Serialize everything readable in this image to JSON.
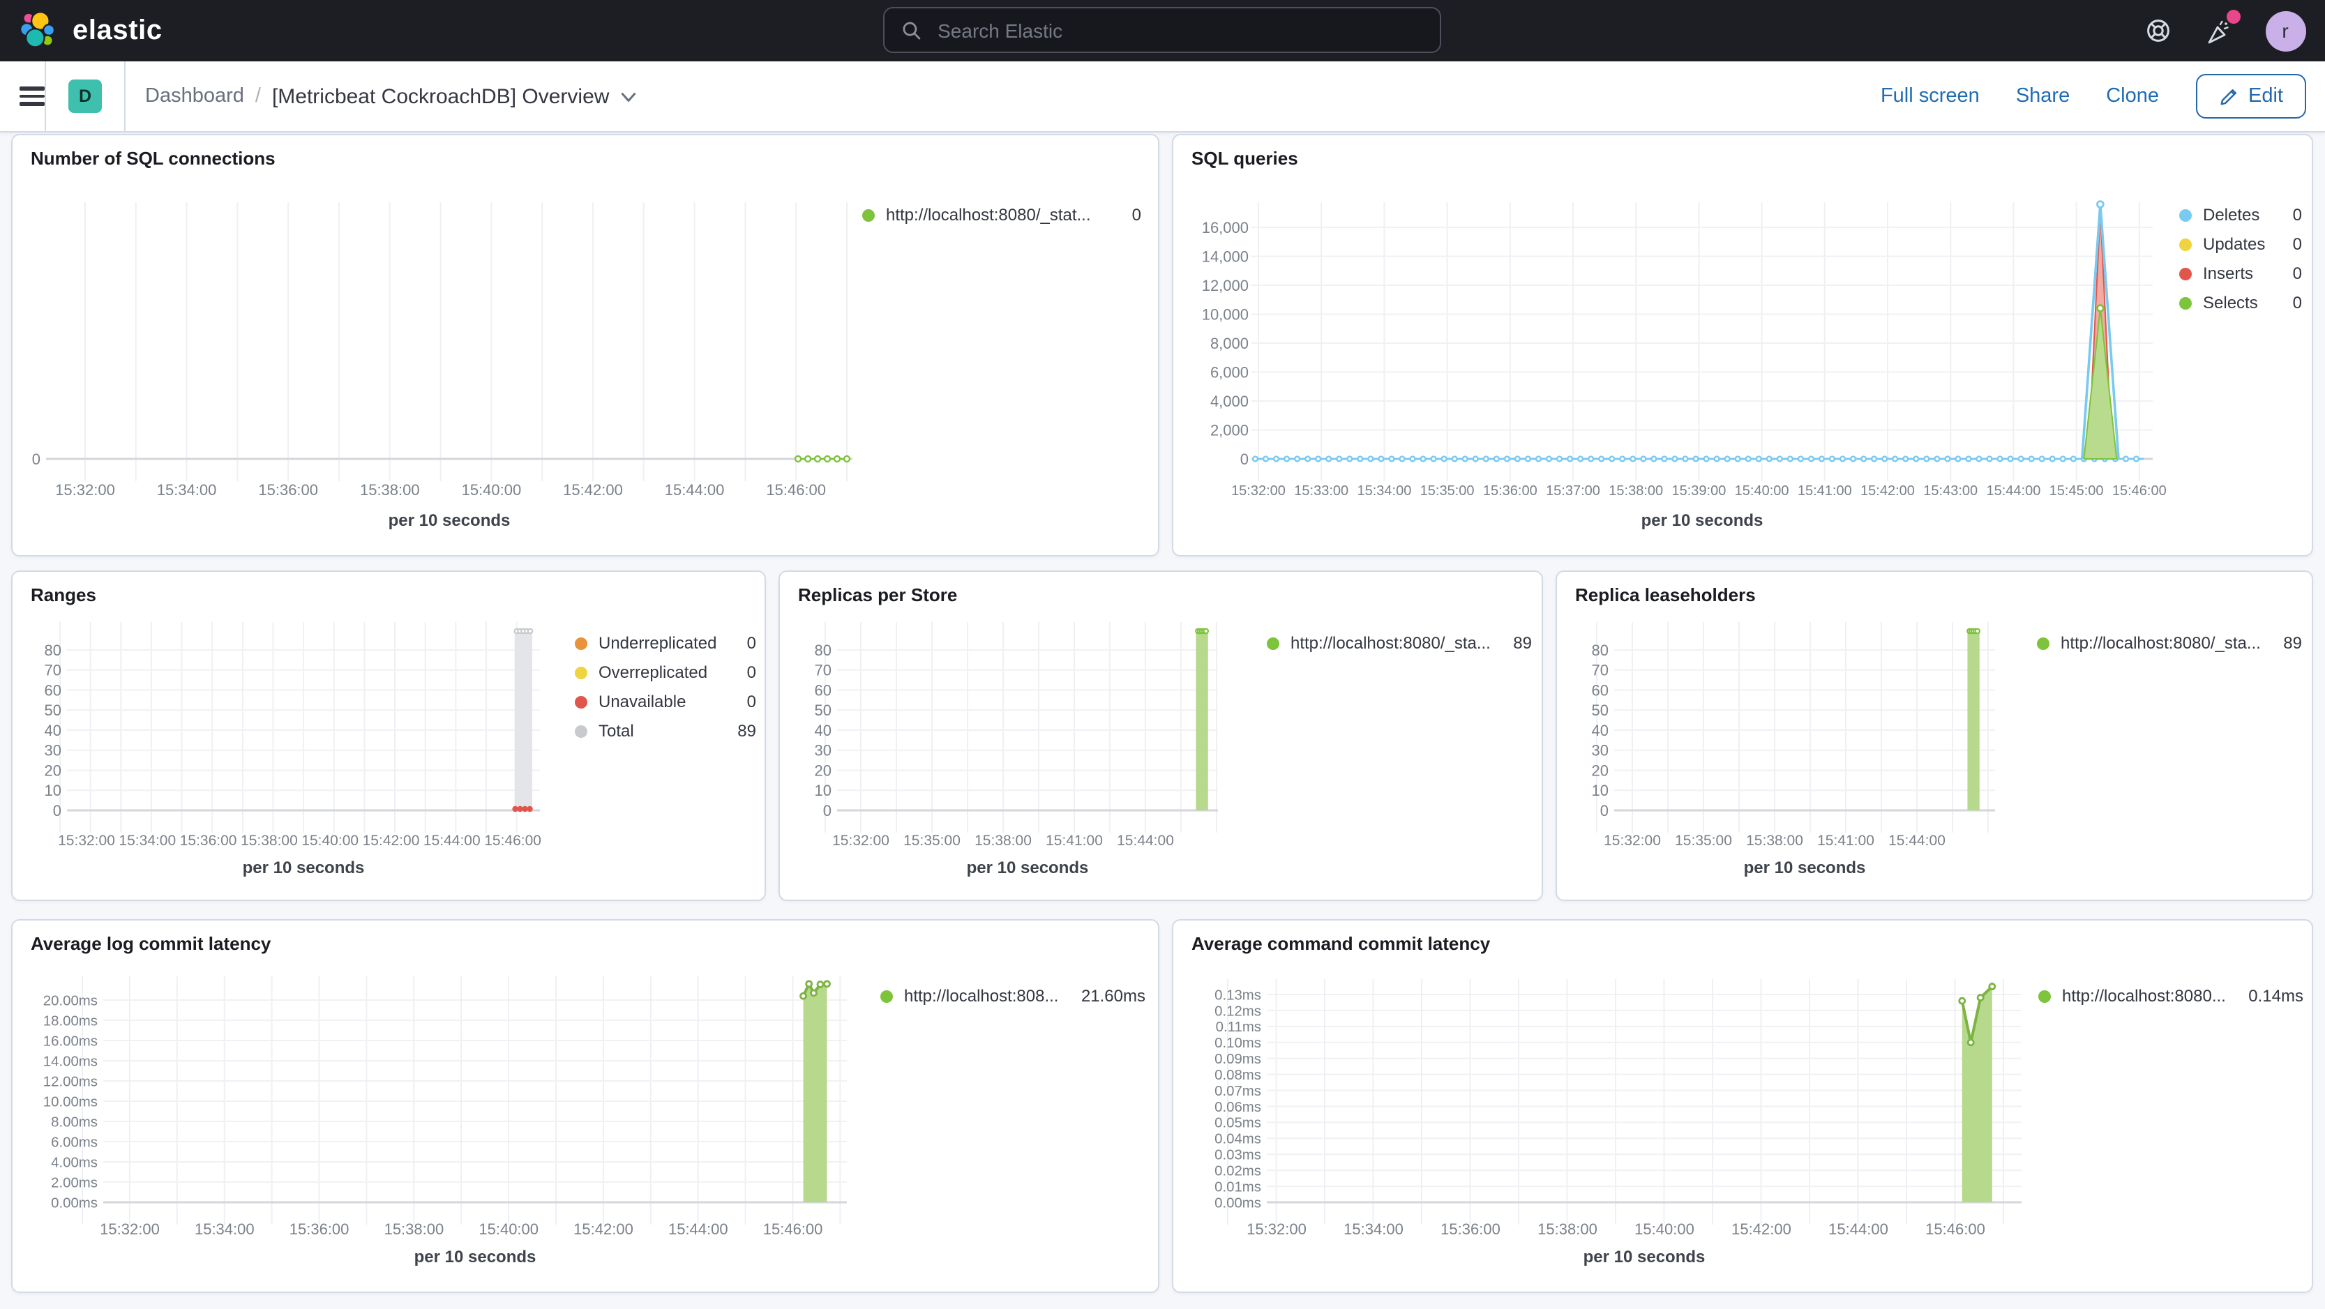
{
  "header": {
    "logo": "elastic",
    "search_placeholder": "Search Elastic",
    "avatar_initial": "r"
  },
  "nav": {
    "badge": "D",
    "breadcrumb_root": "Dashboard",
    "separator": "/",
    "title": "[Metricbeat CockroachDB] Overview",
    "actions": [
      "Full screen",
      "Share",
      "Clone"
    ],
    "edit_label": "Edit"
  },
  "colors": {
    "header_bg": "#1d1e24",
    "page_bg": "#f5f7fa",
    "link_blue": "#1e6cb3",
    "badge_teal": "#3fbfae",
    "accent_pink": "#e8478b",
    "series_green": "#7DC33B",
    "series_blue": "#79C9F1",
    "series_yellow": "#EFD33F",
    "series_red": "#E0564A",
    "series_orange": "#E8933C",
    "series_gray": "#C9CACE"
  },
  "panels": [
    {
      "title": "Number of SQL connections",
      "legend": [
        {
          "color": "#7DC33B",
          "label": "http://localhost:8080/_stat...",
          "value": "0"
        }
      ],
      "chart_data": {
        "type": "line",
        "x_axis_title": "per 10 seconds",
        "x_ticks": [
          "15:32:00",
          "15:34:00",
          "15:36:00",
          "15:38:00",
          "15:40:00",
          "15:42:00",
          "15:44:00",
          "15:46:00"
        ],
        "y_ticks": [
          {
            "v": 0,
            "label": "0"
          }
        ],
        "series": [
          {
            "name": "http://localhost:8080/_stat...",
            "color": "#7DC33B",
            "type": "dotline",
            "value": 0,
            "from_unit": 7.02,
            "to_unit": 7.5,
            "marker_step_unit": 0.096,
            "marker_r": 2
          }
        ]
      }
    },
    {
      "title": "SQL queries",
      "legend": [
        {
          "color": "#79C9F1",
          "label": "Deletes",
          "value": "0"
        },
        {
          "color": "#EFD33F",
          "label": "Updates",
          "value": "0"
        },
        {
          "color": "#E0564A",
          "label": "Inserts",
          "value": "0"
        },
        {
          "color": "#7DC33B",
          "label": "Selects",
          "value": "0"
        }
      ],
      "chart_data": {
        "type": "area",
        "stacked": true,
        "x_axis_title": "per 10 seconds",
        "x_ticks": [
          "15:32:00",
          "15:33:00",
          "15:34:00",
          "15:35:00",
          "15:36:00",
          "15:37:00",
          "15:38:00",
          "15:39:00",
          "15:40:00",
          "15:41:00",
          "15:42:00",
          "15:43:00",
          "15:44:00",
          "15:45:00",
          "15:46:00"
        ],
        "y_ticks": [
          {
            "v": 0,
            "label": "0"
          },
          {
            "v": 2000,
            "label": "2,000"
          },
          {
            "v": 4000,
            "label": "4,000"
          },
          {
            "v": 6000,
            "label": "6,000"
          },
          {
            "v": 8000,
            "label": "8,000"
          },
          {
            "v": 10000,
            "label": "10,000"
          },
          {
            "v": 12000,
            "label": "12,000"
          },
          {
            "v": 14000,
            "label": "14,000"
          },
          {
            "v": 16000,
            "label": "16,000"
          }
        ],
        "series": [
          {
            "name": "Deletes",
            "color": "#79C9F1",
            "type": "dotline",
            "value": 0,
            "from_unit": -0.05,
            "to_unit": 14.07,
            "marker_step_unit": 0.1667,
            "marker_r": 1.7
          },
          {
            "name": "Updates",
            "color": "#EFD33F",
            "type": "none",
            "value": 0
          },
          {
            "name": "Inserts",
            "color": "#E0564A",
            "type": "spike",
            "fill": "#F1ABA2",
            "x_unit": 13.38,
            "half_width_unit": 0.19,
            "peak": 17180,
            "marker": false
          },
          {
            "name": "Selects",
            "color": "#7DC33B",
            "type": "spike",
            "fill": "#B9DB8D",
            "x_unit": 13.38,
            "half_width_unit": 0.26,
            "peak": 10410,
            "marker": true
          },
          {
            "name": "Deletes-spike-outline",
            "color": "#79C9F1",
            "type": "spike",
            "fill": "none",
            "x_unit": 13.38,
            "half_width_unit": 0.29,
            "peak": 17590,
            "marker": true
          }
        ]
      }
    },
    {
      "title": "Ranges",
      "legend": [
        {
          "color": "#E8933C",
          "label": "Underreplicated",
          "value": "0"
        },
        {
          "color": "#EFD33F",
          "label": "Overreplicated",
          "value": "0"
        },
        {
          "color": "#E0564A",
          "label": "Unavailable",
          "value": "0"
        },
        {
          "color": "#C9CACE",
          "label": "Total",
          "value": "89"
        }
      ],
      "chart_data": {
        "type": "bar",
        "x_axis_title": "per 10 seconds",
        "x_ticks": [
          "15:32:00",
          "15:34:00",
          "15:36:00",
          "15:38:00",
          "15:40:00",
          "15:42:00",
          "15:44:00",
          "15:46:00"
        ],
        "y_ticks": [
          {
            "v": 0,
            "label": "0"
          },
          {
            "v": 10,
            "label": "10"
          },
          {
            "v": 20,
            "label": "20"
          },
          {
            "v": 30,
            "label": "30"
          },
          {
            "v": 40,
            "label": "40"
          },
          {
            "v": 50,
            "label": "50"
          },
          {
            "v": 60,
            "label": "60"
          },
          {
            "v": 70,
            "label": "70"
          },
          {
            "v": 80,
            "label": "80"
          }
        ],
        "series": [
          {
            "name": "Total",
            "color": "#C9CACE",
            "type": "bar",
            "fill": "#E4E5E8",
            "x0_unit": 7.03,
            "x1_unit": 7.32,
            "value": 89,
            "top_markers": {
              "color": "#C6C8CC",
              "count": 5
            }
          },
          {
            "name": "Unavailable",
            "color": "#E0564A",
            "type": "dots",
            "from_unit": 7.04,
            "to_unit": 7.28,
            "count": 4,
            "value": 0
          }
        ]
      }
    },
    {
      "title": "Replicas per Store",
      "legend": [
        {
          "color": "#7DC33B",
          "label": "http://localhost:8080/_sta...",
          "value": "89"
        }
      ],
      "chart_data": {
        "type": "bar",
        "x_axis_title": "per 10 seconds",
        "x_ticks": [
          "15:32:00",
          "15:35:00",
          "15:38:00",
          "15:41:00",
          "15:44:00"
        ],
        "y_ticks": [
          {
            "v": 0,
            "label": "0"
          },
          {
            "v": 10,
            "label": "10"
          },
          {
            "v": 20,
            "label": "20"
          },
          {
            "v": 30,
            "label": "30"
          },
          {
            "v": 40,
            "label": "40"
          },
          {
            "v": 50,
            "label": "50"
          },
          {
            "v": 60,
            "label": "60"
          },
          {
            "v": 70,
            "label": "70"
          },
          {
            "v": 80,
            "label": "80"
          }
        ],
        "series": [
          {
            "name": "http://localhost:8080/_sta...",
            "color": "#7DC33B",
            "type": "bar",
            "fill": "#B6D98C",
            "x0_unit": 4.71,
            "x1_unit": 4.88,
            "value": 89,
            "top_markers": {
              "color": "#7DC33B",
              "count": 5
            }
          }
        ]
      }
    },
    {
      "title": "Replica leaseholders",
      "legend": [
        {
          "color": "#7DC33B",
          "label": "http://localhost:8080/_sta...",
          "value": "89"
        }
      ],
      "chart_data": {
        "type": "bar",
        "x_axis_title": "per 10 seconds",
        "x_ticks": [
          "15:32:00",
          "15:35:00",
          "15:38:00",
          "15:41:00",
          "15:44:00"
        ],
        "y_ticks": [
          {
            "v": 0,
            "label": "0"
          },
          {
            "v": 10,
            "label": "10"
          },
          {
            "v": 20,
            "label": "20"
          },
          {
            "v": 30,
            "label": "30"
          },
          {
            "v": 40,
            "label": "40"
          },
          {
            "v": 50,
            "label": "50"
          },
          {
            "v": 60,
            "label": "60"
          },
          {
            "v": 70,
            "label": "70"
          },
          {
            "v": 80,
            "label": "80"
          }
        ],
        "series": [
          {
            "name": "http://localhost:8080/_sta...",
            "color": "#7DC33B",
            "type": "bar",
            "fill": "#B6D98C",
            "x0_unit": 4.71,
            "x1_unit": 4.88,
            "value": 89,
            "top_markers": {
              "color": "#7DC33B",
              "count": 5
            }
          }
        ]
      }
    },
    {
      "title": "Average log commit latency",
      "legend": [
        {
          "color": "#7DC33B",
          "label": "http://localhost:808...",
          "value": "21.60ms"
        }
      ],
      "chart_data": {
        "type": "area",
        "x_axis_title": "per 10 seconds",
        "x_ticks": [
          "15:32:00",
          "15:34:00",
          "15:36:00",
          "15:38:00",
          "15:40:00",
          "15:42:00",
          "15:44:00",
          "15:46:00"
        ],
        "y_ticks": [
          {
            "v": 0,
            "label": "0.00ms"
          },
          {
            "v": 2,
            "label": "2.00ms"
          },
          {
            "v": 4,
            "label": "4.00ms"
          },
          {
            "v": 6,
            "label": "6.00ms"
          },
          {
            "v": 8,
            "label": "8.00ms"
          },
          {
            "v": 10,
            "label": "10.00ms"
          },
          {
            "v": 12,
            "label": "12.00ms"
          },
          {
            "v": 14,
            "label": "14.00ms"
          },
          {
            "v": 16,
            "label": "16.00ms"
          },
          {
            "v": 18,
            "label": "18.00ms"
          },
          {
            "v": 20,
            "label": "20.00ms"
          }
        ],
        "series": [
          {
            "name": "http://localhost:808...",
            "color": "#7CB342",
            "type": "area_line",
            "fill": "#B6D98C",
            "markers": true,
            "points": [
              [
                7.11,
                20.4
              ],
              [
                7.17,
                21.6
              ],
              [
                7.22,
                20.7
              ],
              [
                7.29,
                21.55
              ],
              [
                7.36,
                21.6
              ]
            ]
          }
        ]
      }
    },
    {
      "title": "Average command commit latency",
      "legend": [
        {
          "color": "#7DC33B",
          "label": "http://localhost:8080...",
          "value": "0.14ms"
        }
      ],
      "chart_data": {
        "type": "area",
        "x_axis_title": "per 10 seconds",
        "x_ticks": [
          "15:32:00",
          "15:34:00",
          "15:36:00",
          "15:38:00",
          "15:40:00",
          "15:42:00",
          "15:44:00",
          "15:46:00"
        ],
        "y_ticks": [
          {
            "v": 0,
            "label": "0.00ms"
          },
          {
            "v": 0.01,
            "label": "0.01ms"
          },
          {
            "v": 0.02,
            "label": "0.02ms"
          },
          {
            "v": 0.03,
            "label": "0.03ms"
          },
          {
            "v": 0.04,
            "label": "0.04ms"
          },
          {
            "v": 0.05,
            "label": "0.05ms"
          },
          {
            "v": 0.06,
            "label": "0.06ms"
          },
          {
            "v": 0.07,
            "label": "0.07ms"
          },
          {
            "v": 0.08,
            "label": "0.08ms"
          },
          {
            "v": 0.09,
            "label": "0.09ms"
          },
          {
            "v": 0.1,
            "label": "0.10ms"
          },
          {
            "v": 0.11,
            "label": "0.11ms"
          },
          {
            "v": 0.12,
            "label": "0.12ms"
          },
          {
            "v": 0.13,
            "label": "0.13ms"
          }
        ],
        "series": [
          {
            "name": "http://localhost:8080...",
            "color": "#7CB342",
            "type": "area_line",
            "fill": "#B6D98C",
            "markers": true,
            "points": [
              [
                7.07,
                0.126
              ],
              [
                7.16,
                0.1
              ],
              [
                7.26,
                0.128
              ],
              [
                7.38,
                0.135
              ]
            ]
          }
        ]
      }
    }
  ]
}
